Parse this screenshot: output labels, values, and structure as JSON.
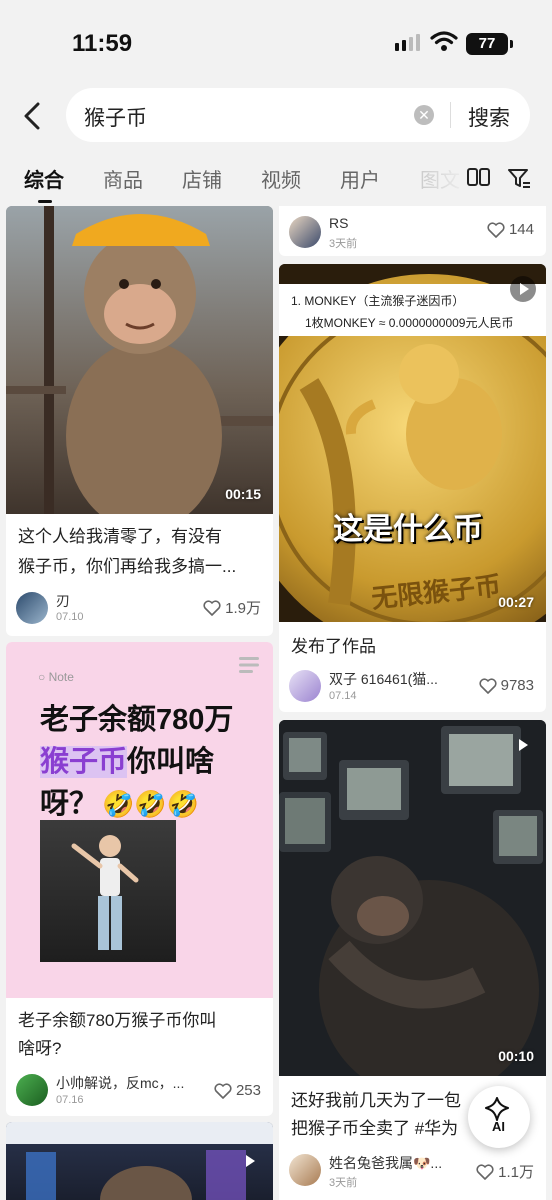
{
  "status_bar": {
    "time": "11:59",
    "battery": "77"
  },
  "search": {
    "query": "猴子币",
    "clear_symbol": "✕",
    "submit_label": "搜索"
  },
  "tabs": [
    "综合",
    "商品",
    "店铺",
    "视频",
    "用户",
    "图文"
  ],
  "cards": [
    {
      "duration": "00:15",
      "title_line1": "这个人给我清零了，有没有",
      "title_line2": "猴子币，你们再给我多搞一...",
      "author": "刃",
      "date": "07.10",
      "likes": "1.9万"
    },
    {
      "author": "RS",
      "date": "3天前",
      "likes": "144"
    },
    {
      "overlay_line1": "1. MONKEY（主流猴子迷因币）",
      "overlay_line2": "1枚MONKEY ≈ 0.0000000009元人民币",
      "caption": "这是什么币",
      "coin_text": "无限猴子币",
      "duration": "00:27",
      "title": "发布了作品",
      "author": "双子 616461(猫...",
      "date": "07.14",
      "likes": "9783"
    },
    {
      "note_label": "Note",
      "headline_line1": "老子余额780万",
      "headline_highlight": "猴子币",
      "headline_line2_rest": "你叫啥",
      "headline_line3": "呀？",
      "emojis": "🤣🤣🤣",
      "title_line1": "老子余额780万猴子币你叫",
      "title_line2": "啥呀?",
      "author": "小帅解说，反mc，...",
      "date": "07.16",
      "likes": "253"
    },
    {
      "duration": "00:10",
      "title_line1": "还好我前几天为了一包",
      "title_line2": "把猴子币全卖了 #华为",
      "author": "姓名兔爸我属🐶...",
      "date": "3天前",
      "likes": "1.1万"
    }
  ],
  "ai_button": {
    "label": "AI"
  }
}
